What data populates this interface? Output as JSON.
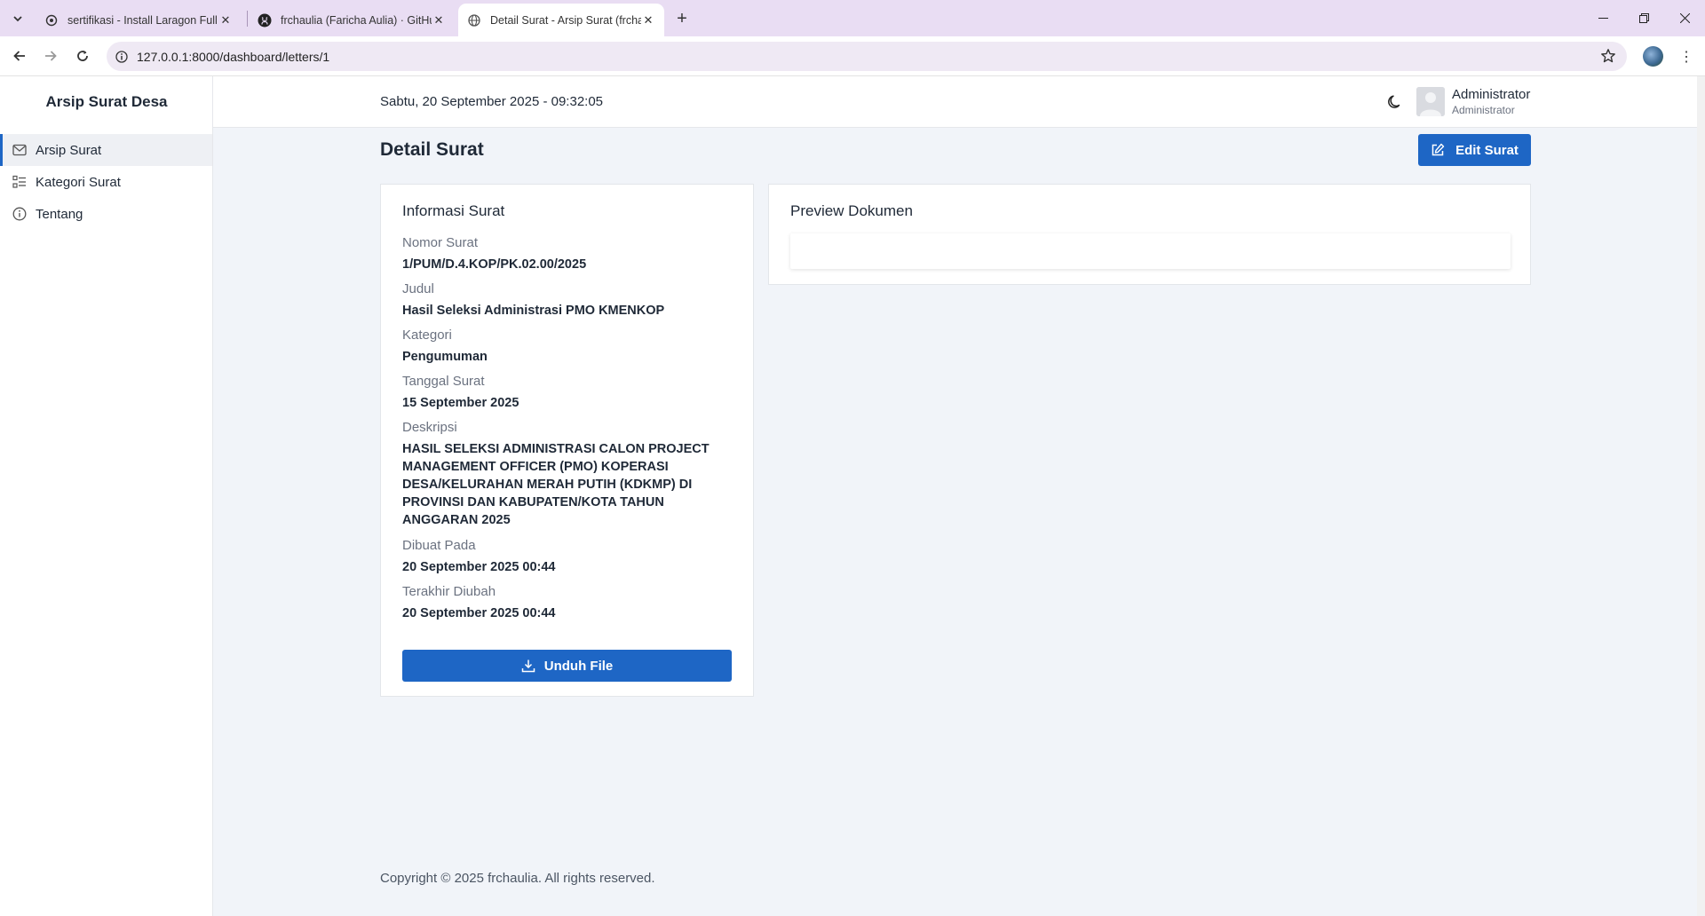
{
  "browser": {
    "tabs": [
      {
        "title": "sertifikasi - Install Laragon Full",
        "icon": "openai-icon",
        "active": false
      },
      {
        "title": "frchaulia (Faricha Aulia) · GitHub",
        "icon": "github-icon",
        "active": false
      },
      {
        "title": "Detail Surat - Arsip Surat (frchaulia)",
        "icon": "globe-icon",
        "active": true
      }
    ],
    "url": "127.0.0.1:8000/dashboard/letters/1"
  },
  "sidebar": {
    "brand": "Arsip Surat Desa",
    "items": [
      {
        "label": "Arsip Surat",
        "icon": "mail-icon",
        "active": true
      },
      {
        "label": "Kategori Surat",
        "icon": "list-icon",
        "active": false
      },
      {
        "label": "Tentang",
        "icon": "info-icon",
        "active": false
      }
    ]
  },
  "topbar": {
    "datetime": "Sabtu, 20 September 2025 - 09:32:05",
    "user_name": "Administrator",
    "user_role": "Administrator"
  },
  "page": {
    "title": "Detail Surat",
    "edit_button": "Edit Surat"
  },
  "info": {
    "title": "Informasi Surat",
    "fields": [
      {
        "label": "Nomor Surat",
        "value": "1/PUM/D.4.KOP/PK.02.00/2025"
      },
      {
        "label": "Judul",
        "value": "Hasil Seleksi Administrasi PMO KMENKOP"
      },
      {
        "label": "Kategori",
        "value": "Pengumuman"
      },
      {
        "label": "Tanggal Surat",
        "value": "15 September 2025"
      },
      {
        "label": "Deskripsi",
        "value": "HASIL SELEKSI ADMINISTRASI CALON PROJECT MANAGEMENT OFFICER (PMO) KOPERASI DESA/KELURAHAN MERAH PUTIH (KDKMP) DI PROVINSI DAN KABUPATEN/KOTA TAHUN ANGGARAN 2025"
      },
      {
        "label": "Dibuat Pada",
        "value": "20 September 2025 00:44"
      },
      {
        "label": "Terakhir Diubah",
        "value": "20 September 2025 00:44"
      }
    ],
    "download_button": "Unduh File"
  },
  "preview": {
    "title": "Preview Dokumen"
  },
  "footer": {
    "text": "Copyright © 2025 frchaulia. All rights reserved."
  },
  "colors": {
    "primary": "#1e66c5",
    "page_bg": "#f1f4f9",
    "tabbar_bg": "#e9ddf3"
  }
}
